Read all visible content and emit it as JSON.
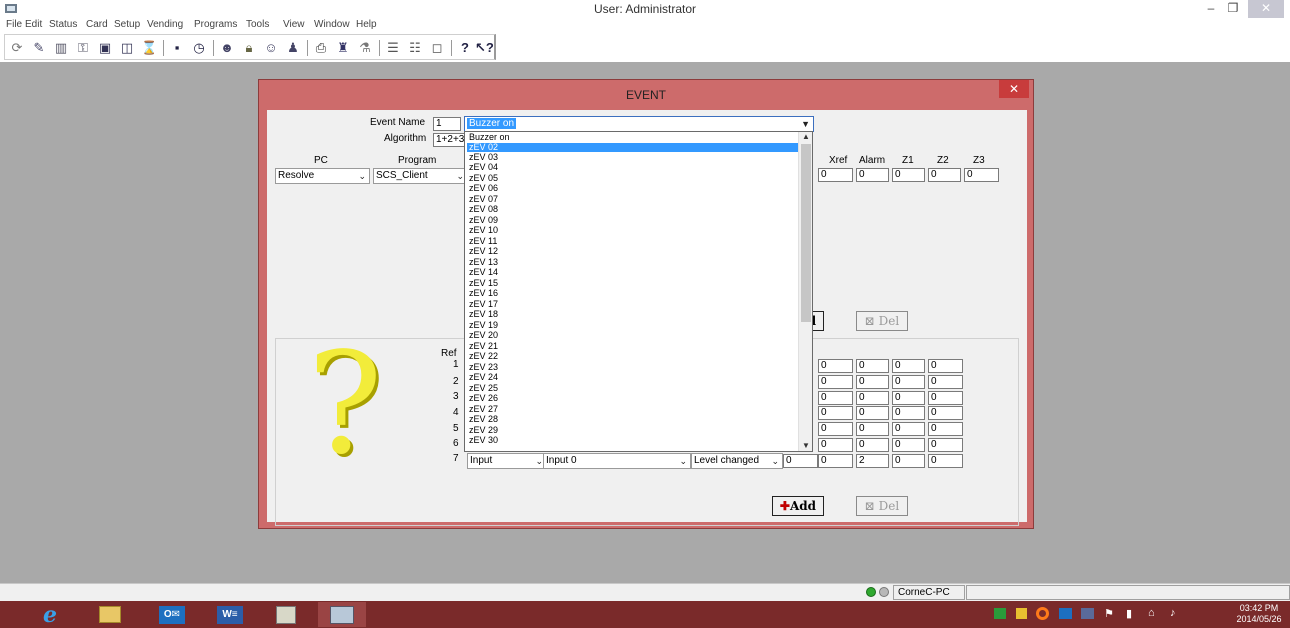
{
  "window": {
    "title": "User: Administrator",
    "min_glyph": "–",
    "max_glyph": "❐",
    "close_glyph": "✕"
  },
  "menu": [
    "File",
    "Edit",
    "Status",
    "Card",
    "Setup",
    "Vending",
    "Programs",
    "Tools",
    "View",
    "Window",
    "Help"
  ],
  "toolbar_icons": [
    "cycle-icon",
    "card-icon",
    "building-icon",
    "keys-icon",
    "card-reader-icon",
    "door-icon",
    "hourglass-icon",
    "save-icon",
    "clock-icon",
    "users-icon",
    "lock-icon",
    "group-icon",
    "person-icon",
    "printer-icon",
    "lamp-icon",
    "vending-icon",
    "cascade-icon",
    "tile-icon",
    "window-icon",
    "help-icon",
    "context-help-icon"
  ],
  "dialog": {
    "title": "EVENT",
    "close_glyph": "✕",
    "event_name_label": "Event Name",
    "event_number": "1",
    "event_name_value": "Buzzer on",
    "algorithm_label": "Algorithm",
    "algorithm_value": "1+2+3",
    "pc_label": "PC",
    "program_label": "Program",
    "pc_value": "Resolve",
    "program_value": "SCS_Client",
    "top_columns": {
      "labels": [
        "Xref",
        "Alarm",
        "Z1",
        "Z2",
        "Z3"
      ],
      "values": [
        "0",
        "0",
        "0",
        "0",
        "0"
      ]
    },
    "top_buttons": {
      "add": "d",
      "del": "Del"
    },
    "ref_label": "Ref",
    "refs": [
      {
        "num": "1",
        "values": [
          "0",
          "0",
          "0",
          "0"
        ]
      },
      {
        "num": "2",
        "values": [
          "0",
          "0",
          "0",
          "0"
        ]
      },
      {
        "num": "3",
        "values": [
          "0",
          "0",
          "0",
          "0"
        ]
      },
      {
        "num": "4",
        "values": [
          "0",
          "0",
          "0",
          "0"
        ]
      },
      {
        "num": "5",
        "values": [
          "0",
          "0",
          "0",
          "0"
        ]
      },
      {
        "num": "6",
        "values": [
          "0",
          "0",
          "0",
          "0"
        ]
      },
      {
        "num": "7",
        "type": "Input",
        "input": "Input 0",
        "trigger": "Level changed",
        "values": [
          "0",
          "0",
          "2",
          "0",
          "0"
        ]
      }
    ],
    "bottom_buttons": {
      "add": "Add",
      "del": "Del"
    },
    "question_glyph": "?"
  },
  "dropdown": {
    "items": [
      "Buzzer on",
      "zEV 02",
      "zEV 03",
      "zEV 04",
      "zEV 05",
      "zEV 06",
      "zEV 07",
      "zEV 08",
      "zEV 09",
      "zEV 10",
      "zEV 11",
      "zEV 12",
      "zEV 13",
      "zEV 14",
      "zEV 15",
      "zEV 16",
      "zEV 17",
      "zEV 18",
      "zEV 19",
      "zEV 20",
      "zEV 21",
      "zEV 22",
      "zEV 23",
      "zEV 24",
      "zEV 25",
      "zEV 26",
      "zEV 27",
      "zEV 28",
      "zEV 29",
      "zEV 30"
    ],
    "highlighted_index": 1
  },
  "statusbar": {
    "computer": "CorneC-PC"
  },
  "taskbar": {
    "time": "03:42 PM",
    "date": "2014/05/26"
  },
  "colors": {
    "dialog_frame": "#cd6b6b",
    "selection": "#3399ff",
    "taskbar": "#7a2a2a",
    "mdi_background": "#a9a9a9"
  }
}
